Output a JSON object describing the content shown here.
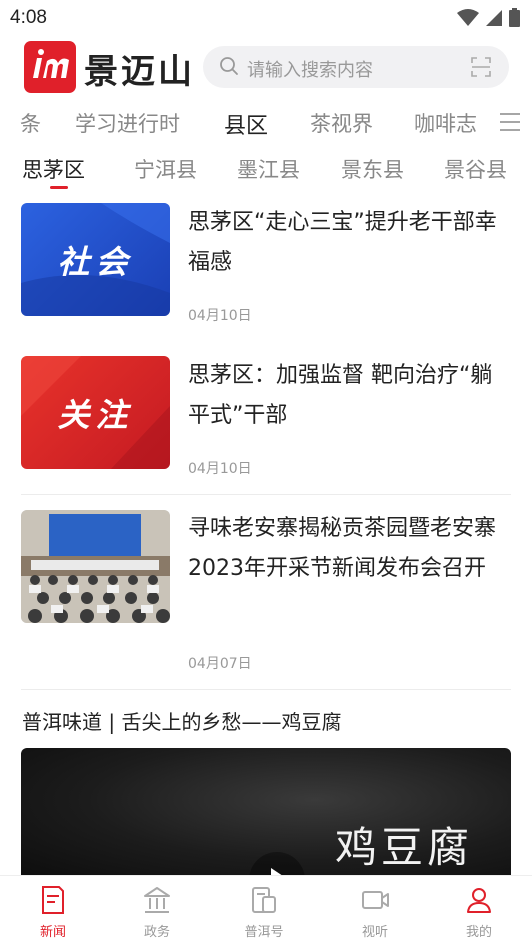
{
  "status_bar": {
    "time": "4:08"
  },
  "header": {
    "logo_text": "景迈山",
    "search_placeholder": "请输入搜索内容"
  },
  "channel_tabs": [
    "条",
    "学习进行时",
    "县区",
    "茶视界",
    "咖啡志"
  ],
  "channel_active": "县区",
  "district_tabs": [
    "思茅区",
    "宁洱县",
    "墨江县",
    "景东县",
    "景谷县"
  ],
  "district_active": "思茅区",
  "news": [
    {
      "title": "思茅区“走心三宝”提升老干部幸福感",
      "date": "04月10日",
      "thumb_label": "社会"
    },
    {
      "title": "思茅区：加强监督  靶向治疗“躺平式”干部",
      "date": "04月10日",
      "thumb_label": "关注"
    },
    {
      "title": "寻味老安寨揭秘贡茶园暨老安寨2023年开采节新闻发布会召开",
      "date": "04月07日",
      "thumb_label": ""
    }
  ],
  "video": {
    "title": "普洱味道 | 舌尖上的乡愁——鸡豆腐",
    "thumb_text": "鸡豆腐"
  },
  "bottom_nav": [
    {
      "label": "新闻",
      "icon": "news-icon"
    },
    {
      "label": "政务",
      "icon": "government-icon"
    },
    {
      "label": "普洱号",
      "icon": "puer-account-icon"
    },
    {
      "label": "视听",
      "icon": "video-icon"
    },
    {
      "label": "我的",
      "icon": "profile-icon"
    }
  ],
  "bottom_nav_active": "新闻",
  "colors": {
    "brand_red": "#e0202a",
    "blue_card": "#1e4fc9",
    "red_card": "#d8232a"
  }
}
